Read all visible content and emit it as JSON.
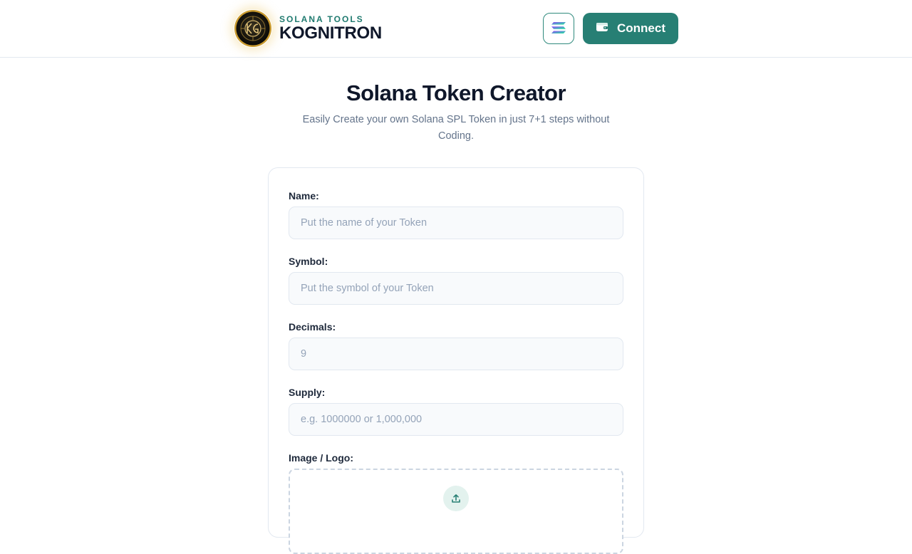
{
  "header": {
    "brand_eyebrow": "SOLANA TOOLS",
    "brand_title": "KOGNITRON",
    "logo_icon": "kognitron-logo",
    "network_icon": "solana-icon",
    "connect_icon": "wallet-icon",
    "connect_label": "Connect"
  },
  "page": {
    "title": "Solana Token Creator",
    "subtitle": "Easily Create your own Solana SPL Token in just 7+1 steps without Coding."
  },
  "form": {
    "name": {
      "label": "Name:",
      "value": "",
      "placeholder": "Put the name of your Token"
    },
    "symbol": {
      "label": "Symbol:",
      "value": "",
      "placeholder": "Put the symbol of your Token"
    },
    "decimals": {
      "label": "Decimals:",
      "value": "",
      "placeholder": "9"
    },
    "supply": {
      "label": "Supply:",
      "value": "",
      "placeholder": "e.g. 1000000 or 1,000,000"
    },
    "image": {
      "label": "Image / Logo:",
      "icon": "upload-icon"
    }
  },
  "colors": {
    "accent": "#277f74",
    "brand_eyebrow": "#1f7a6f",
    "text_primary": "#0f172a",
    "text_muted": "#64748b",
    "input_bg": "#f8fafc",
    "upload_bg": "#e3f2ee"
  }
}
